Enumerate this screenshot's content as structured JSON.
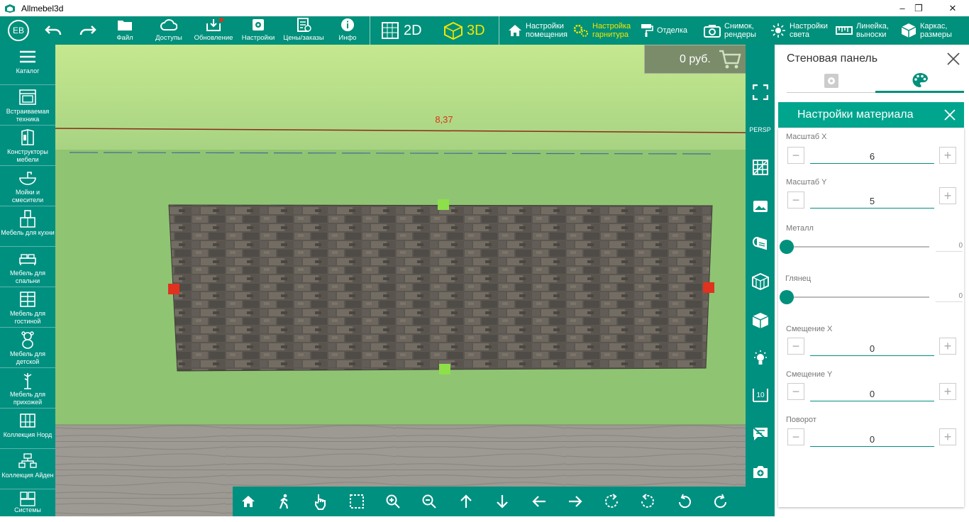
{
  "window": {
    "title": "Allmebel3d",
    "minimize": "–",
    "maximize": "❐",
    "close": "✕"
  },
  "toolbar": {
    "avatar": "EB",
    "file": "Файл",
    "access": "Доступы",
    "update": "Обновление",
    "settings": "Настройки",
    "prices": "Цены/заказы",
    "info": "Инфо",
    "mode2d": "2D",
    "mode3d": "3D",
    "room_settings": [
      "Настройки",
      "помещения"
    ],
    "set_settings": [
      "Настройка",
      "гарнитура"
    ],
    "finishing": "Отделка",
    "snapshot": [
      "Снимок,",
      "рендеры"
    ],
    "light": [
      "Настройки",
      "света"
    ],
    "ruler": [
      "Линейка,",
      "выноски"
    ],
    "frame": [
      "Каркас,",
      "размеры"
    ]
  },
  "sidebar": {
    "items": [
      "Каталог",
      "Встраиваемая техника",
      "Конструкторы мебели",
      "Мойки и смесители",
      "Мебель для кухни",
      "Мебель для спальни",
      "Мебель для гостиной",
      "Мебель для детской",
      "Мебель для прихожей",
      "Коллекция Норд",
      "Коллекция Айден",
      "Системы хранения"
    ]
  },
  "viewport": {
    "dimension_label": "8,37",
    "price": "0 руб.",
    "persp_label": "PERSP"
  },
  "panel": {
    "title": "Стеновая панель",
    "material_header": "Настройки материала",
    "scale_x_label": "Масштаб X",
    "scale_x_value": "6",
    "scale_y_label": "Масштаб Y",
    "scale_y_value": "5",
    "metal_label": "Металл",
    "metal_value": "0",
    "gloss_label": "Глянец",
    "gloss_value": "0",
    "offset_x_label": "Смещение X",
    "offset_x_value": "0",
    "offset_y_label": "Смещение Y",
    "offset_y_value": "0",
    "rotation_label": "Поворот",
    "rotation_value": "0",
    "minus": "−",
    "plus": "+"
  },
  "colors": {
    "accent": "#00907b",
    "highlight": "#f5e600",
    "wall": "#8fc473",
    "handle_green": "#8ee04a",
    "handle_red": "#e0321e"
  }
}
